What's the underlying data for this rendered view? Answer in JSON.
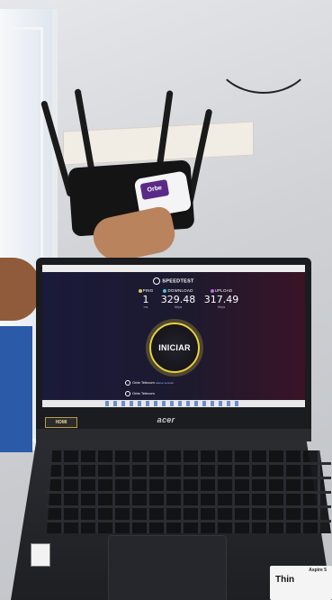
{
  "laptop": {
    "brand_logo": "acer",
    "corner_sticker": "HDMI",
    "model_sticker_brand": "Aspire 5",
    "model_sticker_text": "Thin"
  },
  "device": {
    "label": "Orbe"
  },
  "speedtest": {
    "logo": "SPEEDTEST",
    "ping": {
      "label": "PING",
      "value": "1",
      "unit": "ms"
    },
    "download": {
      "label": "DOWNLOAD",
      "value": "329.48",
      "unit": "Mbps"
    },
    "upload": {
      "label": "UPLOAD",
      "value": "317.49",
      "unit": "Mbps"
    },
    "start_button": "INICIAR",
    "provider": "Orbe Telecom",
    "provider_sub": "Alterar servidor",
    "isp": "Orbe Telecom"
  },
  "colors": {
    "ring": "#e8d23a",
    "screen_bg_left": "#1a1a3a",
    "screen_bg_right": "#3a1326",
    "ping_dot": "#d9c95a",
    "download_dot": "#49c6e5",
    "upload_dot": "#b86ad9"
  }
}
